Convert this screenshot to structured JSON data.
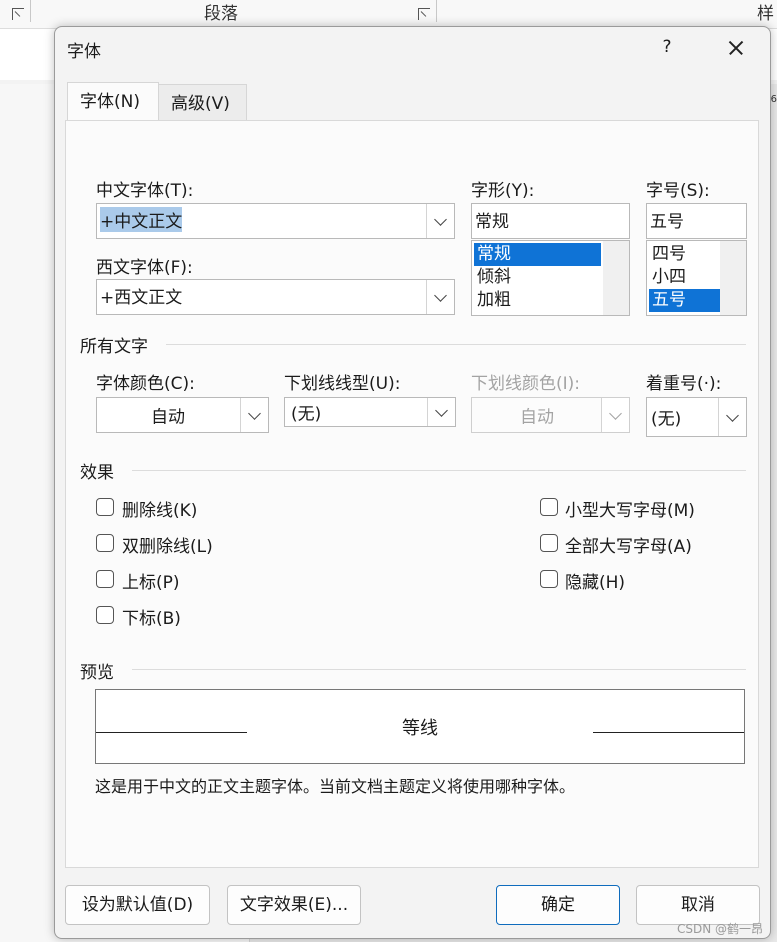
{
  "ribbon": {
    "section_paragraph": "段落",
    "section_style": "样",
    "ruler_mark": "6"
  },
  "dialog": {
    "title": "字体",
    "help": "?",
    "tabs": [
      {
        "label": "字体(N)"
      },
      {
        "label": "高级(V)"
      }
    ],
    "chinese_font": {
      "label": "中文字体(T):",
      "value": "+中文正文"
    },
    "western_font": {
      "label": "西文字体(F):",
      "value": "+西文正文"
    },
    "font_style": {
      "label": "字形(Y):",
      "value": "常规",
      "options": [
        "常规",
        "倾斜",
        "加粗"
      ],
      "selected": "常规"
    },
    "font_size": {
      "label": "字号(S):",
      "value": "五号",
      "options": [
        "四号",
        "小四",
        "五号"
      ],
      "selected": "五号"
    },
    "all_text": {
      "heading": "所有文字",
      "font_color": {
        "label": "字体颜色(C):",
        "value": "自动"
      },
      "underline_style": {
        "label": "下划线线型(U):",
        "value": "(无)"
      },
      "underline_color": {
        "label": "下划线颜色(I):",
        "value": "自动"
      },
      "emphasis_mark": {
        "label": "着重号(·):",
        "value": "(无)"
      }
    },
    "effects": {
      "heading": "效果",
      "left": [
        {
          "label": "删除线(K)",
          "checked": false
        },
        {
          "label": "双删除线(L)",
          "checked": false
        },
        {
          "label": "上标(P)",
          "checked": false
        },
        {
          "label": "下标(B)",
          "checked": false
        }
      ],
      "right": [
        {
          "label": "小型大写字母(M)",
          "checked": false
        },
        {
          "label": "全部大写字母(A)",
          "checked": false
        },
        {
          "label": "隐藏(H)",
          "checked": false
        }
      ]
    },
    "preview": {
      "heading": "预览",
      "sample": "等线",
      "description": "这是用于中文的正文主题字体。当前文档主题定义将使用哪种字体。"
    },
    "buttons": {
      "set_default": "设为默认值(D)",
      "text_effects": "文字效果(E)...",
      "ok": "确定",
      "cancel": "取消"
    }
  },
  "watermark": "CSDN @鹤一昂",
  "colors": {
    "accent": "#0f73d6",
    "selection": "#aacaea"
  }
}
